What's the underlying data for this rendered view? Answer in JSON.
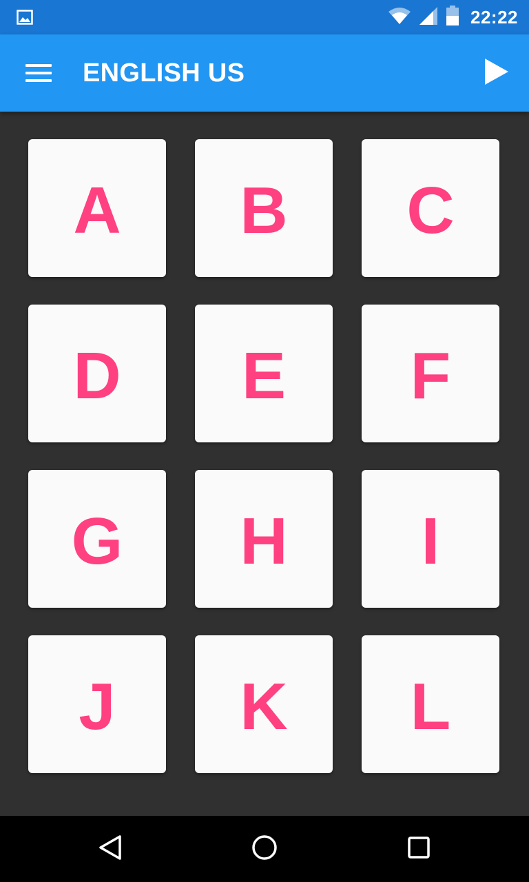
{
  "status_bar": {
    "time": "22:22",
    "background_color": "#1976D2",
    "left_icon": "image-notification-icon",
    "right_icons": [
      "wifi-icon",
      "cell-signal-icon",
      "battery-icon"
    ]
  },
  "app_bar": {
    "title": "ENGLISH US",
    "background_color": "#2196F3",
    "menu_icon": "hamburger-menu-icon",
    "action_icon": "play-icon"
  },
  "tiles": {
    "letters": [
      "A",
      "B",
      "C",
      "D",
      "E",
      "F",
      "G",
      "H",
      "I",
      "J",
      "K",
      "L"
    ],
    "tile_color": "#FAFAFA",
    "letter_color": "#FF4081"
  },
  "background_color": "#303030",
  "nav_bar": {
    "buttons": [
      "back-icon",
      "home-icon",
      "recents-icon"
    ],
    "background_color": "#000000"
  }
}
